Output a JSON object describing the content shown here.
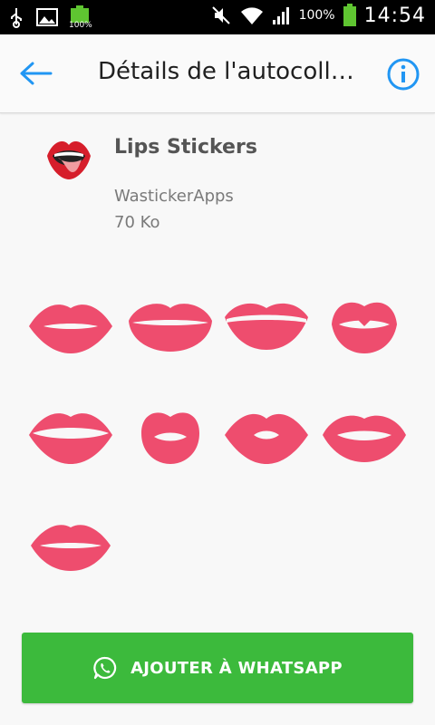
{
  "status_bar": {
    "battery_small_label": "100%",
    "battery_percent": "100%",
    "time": "14:54"
  },
  "app_bar": {
    "title": "Détails de l'autocoll…",
    "back_icon": "arrow-back-icon",
    "info_icon": "info-icon",
    "accent_color": "#2196F3"
  },
  "pack": {
    "name": "Lips Stickers",
    "publisher": "WastickerApps",
    "size": "70 Ko",
    "icon": "lips-tongue-icon"
  },
  "stickers": [
    {
      "label": "lips-sticker-1"
    },
    {
      "label": "lips-sticker-2"
    },
    {
      "label": "lips-sticker-3"
    },
    {
      "label": "lips-sticker-4"
    },
    {
      "label": "lips-sticker-5"
    },
    {
      "label": "lips-sticker-6"
    },
    {
      "label": "lips-sticker-7"
    },
    {
      "label": "lips-sticker-8"
    },
    {
      "label": "lips-sticker-9"
    }
  ],
  "add_button": {
    "label": "AJOUTER À WHATSAPP",
    "color": "#3CBA3C",
    "icon": "whatsapp-icon"
  },
  "colors": {
    "lips": "#EE4D6E"
  }
}
